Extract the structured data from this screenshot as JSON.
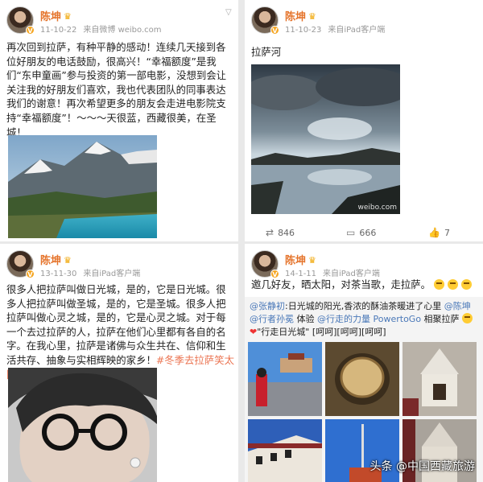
{
  "user": {
    "name": "陈坤",
    "vip_glyph": "♛",
    "verified_glyph": "V"
  },
  "post1": {
    "time": "11-10-22",
    "source": "来自微博 weibo.com",
    "text": "再次回到拉萨，有种平静的感动！连续几天接到各位好朋友的电话鼓励，很高兴！“幸福额度”是我们“东申童画”参与投资的第一部电影，没想到会让关注我的好朋友们喜欢，我也代表团队的同事表达我们的谢意！再次希望更多的朋友会走进电影院支持“幸福额度”！～～～天很蓝，西藏很美，在圣城！",
    "image_icon": "mountain-lake-photo"
  },
  "post2": {
    "time": "11-10-23",
    "source": "来自iPad客户端",
    "text": "拉萨河",
    "image_watermark": "weibo.com",
    "stats": {
      "reposts": "846",
      "comments": "666",
      "likes": "7"
    }
  },
  "post3": {
    "time": "13-11-30",
    "source": "来自iPad客户端",
    "text": "很多人把拉萨叫做日光城，是的，它是日光城。很多人把拉萨叫做圣城，是的，它是圣城。很多人把拉萨叫做心灵之城，是的，它是心灵之城。对于每一个去过拉萨的人，拉萨在他们心里都有各自的名字。在我心里，拉萨是诸佛与众生共在、信仰和生活共存、抽象与实相辉映的家乡！",
    "hashtag": "#冬季去拉萨笑太阳#"
  },
  "post4": {
    "time": "14-1-11",
    "source": "来自iPad客户端",
    "text": "邀几好友，晒太阳，对茶当歌，走拉萨。",
    "repost": {
      "author": "@张静初",
      "line1": ":日光城的阳光,香浓的酥油茶暖进了心里",
      "mention1": "@陈坤",
      "mention2": "@行者孙冕",
      "mid": " 体验 ",
      "mention3": "@行走的力量 PowertoGo",
      "tail": " 相聚拉萨",
      "line3": "\"行走日光城\" [呵呵][呵呵][呵呵]"
    }
  },
  "footer_watermark": "头条 @中国西藏旅游"
}
